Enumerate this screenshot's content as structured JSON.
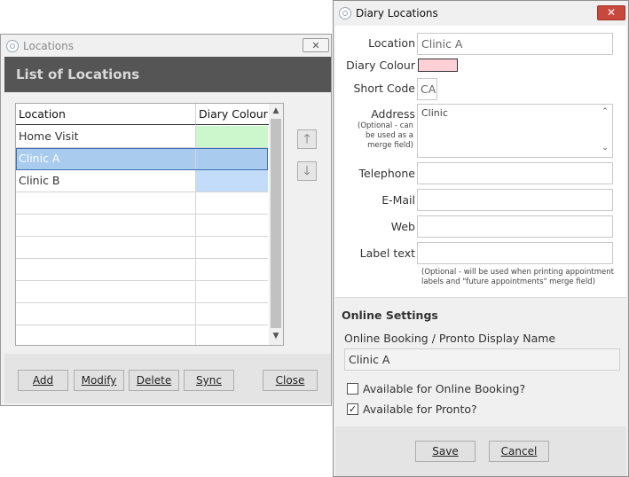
{
  "locations_window": {
    "title": "Locations",
    "close_glyph": "✕",
    "header_title": "List of Locations",
    "columns": [
      "Location",
      "Diary Colour"
    ],
    "rows": [
      {
        "location": "Home Visit",
        "colour": "#ccf7cc",
        "selected": false
      },
      {
        "location": "Clinic A",
        "colour": "#a8cbee",
        "selected": true
      },
      {
        "location": "Clinic B",
        "colour": "#c2dcfa",
        "selected": false
      },
      {
        "location": "",
        "colour": "",
        "selected": false
      },
      {
        "location": "",
        "colour": "",
        "selected": false
      },
      {
        "location": "",
        "colour": "",
        "selected": false
      },
      {
        "location": "",
        "colour": "",
        "selected": false
      },
      {
        "location": "",
        "colour": "",
        "selected": false
      },
      {
        "location": "",
        "colour": "",
        "selected": false
      },
      {
        "location": "",
        "colour": "",
        "selected": false
      }
    ],
    "scroll_up": "▲",
    "scroll_down": "▼",
    "move_up_glyph": "🡑",
    "move_down_glyph": "🡓",
    "buttons": {
      "add": "Add",
      "modify": "Modify",
      "delete": "Delete",
      "sync": "Sync",
      "close": "Close"
    }
  },
  "diary_window": {
    "title": "Diary Locations",
    "close_glyph": "✕",
    "fields": {
      "location_label": "Location",
      "location_value": "Clinic A",
      "diary_colour_label": "Diary Colour",
      "diary_colour_value": "#ffd0d8",
      "short_code_label": "Short Code",
      "short_code_value": "CA",
      "address_label": "Address",
      "address_note": "(Optional - can be used as a merge field)",
      "address_value": "Clinic",
      "telephone_label": "Telephone",
      "telephone_value": "",
      "email_label": "E-Mail",
      "email_value": "",
      "web_label": "Web",
      "web_value": "",
      "label_text_label": "Label text",
      "label_text_value": "",
      "label_text_note": "(Optional - will be used when printing appointment labels and \"future appointments\" merge field)"
    },
    "online": {
      "section_title": "Online Settings",
      "display_name_label": "Online Booking / Pronto Display Name",
      "display_name_value": "Clinic A",
      "online_booking_label": "Available for Online Booking?",
      "online_booking_checked": false,
      "pronto_label": "Available for Pronto?",
      "pronto_checked": true,
      "check_glyph": "✓"
    },
    "buttons": {
      "save": "Save",
      "cancel": "Cancel"
    }
  }
}
